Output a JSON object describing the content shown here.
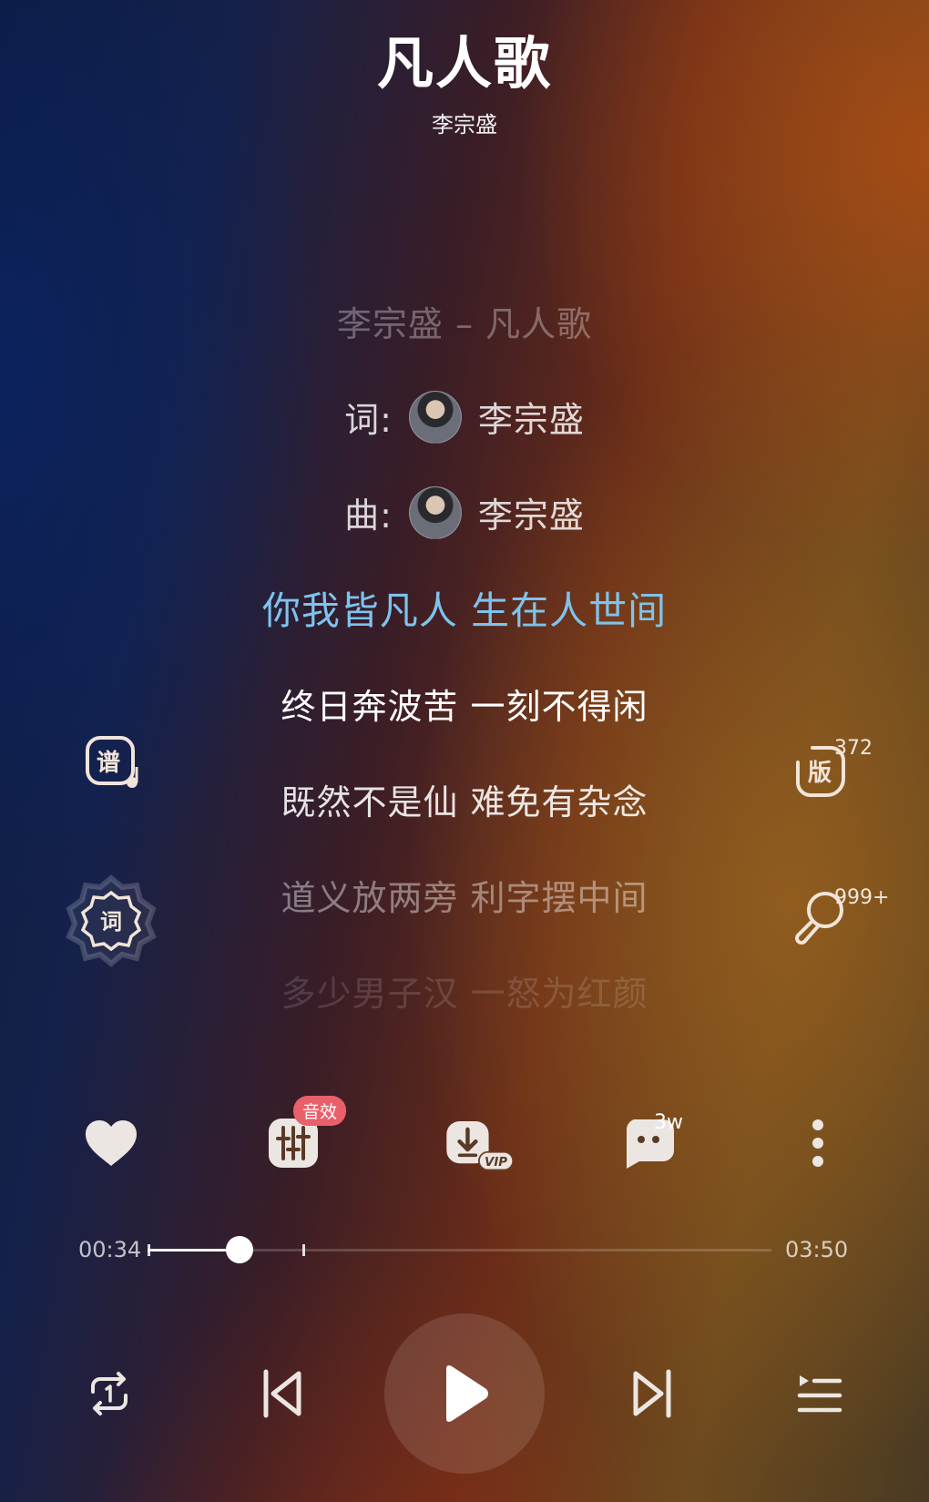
{
  "song": {
    "title": "凡人歌",
    "artist": "李宗盛"
  },
  "lyrics": {
    "header": "李宗盛 – 凡人歌",
    "lyricist_label": "词:",
    "lyricist_name": "李宗盛",
    "composer_label": "曲:",
    "composer_name": "李宗盛",
    "lines": [
      "你我皆凡人 生在人世间",
      "终日奔波苦 一刻不得闲",
      "既然不是仙 难免有杂念",
      "道义放两旁 利字摆中间",
      "多少男子汉 一怒为红颜"
    ]
  },
  "side": {
    "score_icon_label": "谱",
    "lyrics_icon_label": "词",
    "version_icon_label": "版",
    "version_count": "372",
    "karaoke_count": "999+"
  },
  "actions": {
    "sound_effect_badge": "音效",
    "download_badge": "VIP",
    "comment_count": "3w"
  },
  "progress": {
    "current_time": "00:34",
    "total_time": "03:50",
    "fraction": 0.148
  },
  "colors": {
    "current_lyric": "#7ec3ee",
    "sound_badge": "#e9606a"
  }
}
